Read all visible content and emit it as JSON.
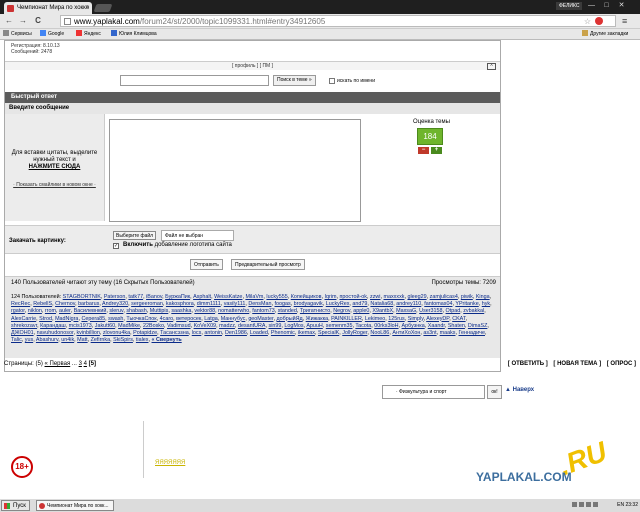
{
  "browser": {
    "tab_title": "Чемпионат Мира по хокке",
    "tab_close": "×",
    "user_label": "ФЕЛИКС",
    "url_host": "www.yaplakal.com",
    "url_path": "/forum24/st/2000/topic1099331.html#entry34912605",
    "win_min": "—",
    "win_max": "□",
    "win_close": "✕",
    "back": "←",
    "forward": "→",
    "reload": "C",
    "star": "☆",
    "menu": "≡"
  },
  "bookmarks": {
    "items": [
      "Сервисы",
      "Google",
      "Яндекс",
      "Юлия Климцова"
    ],
    "other": "Другие закладки"
  },
  "post": {
    "registration": "Регистрация: 8.10.13",
    "messages": "Сообщений: 2478",
    "profile_row": "[ профиль ] [ ПМ ]",
    "up": "^"
  },
  "search": {
    "button": "Поиск в теме »",
    "checkbox_label": "искать по имени"
  },
  "quick_reply": {
    "header": "Быстрый ответ",
    "message_label": "Введите сообщение",
    "quote_hint": "Для вставки цитаты, выделите нужный текст и",
    "quote_action": "НАЖМИТЕ СЮДА",
    "smilies_link": "· Показать смайлики в новом окне ·",
    "rating_title": "Оценка темы",
    "rating_value": "184",
    "rating_minus": "−",
    "rating_plus": "+"
  },
  "attachment": {
    "label": "Закачать картинку:",
    "choose_button": "Выберите файл",
    "file_info": "Файл не выбран",
    "watermark_check": "✓",
    "watermark_bold": "Включить",
    "watermark_rest": " добавление логотипа сайта"
  },
  "actions": {
    "send": "Отправить",
    "preview": "Предварительный просмотр"
  },
  "online": {
    "title": "140 Пользователей читают эту тему (16 Скрытых Пользователей)",
    "views": "Просмотры темы: 7209",
    "prefix": "124 Пользователей:",
    "users": [
      "STAGBORTNIK",
      "Paterson",
      "tatk77",
      "iBanov",
      "БуржаПик",
      "Asphalt",
      "WeissKatze",
      "MilaVm",
      "lucky555",
      "Копейщиков",
      "Iqrim",
      "простой-ok",
      "zzwi",
      "maxxxxk",
      "gleeg29",
      "zamjulicas4",
      "piwik",
      "Kinga",
      "RecRec",
      "RebellS",
      "Chernov",
      "barbarus",
      "Andrey320",
      "sergeeroman",
      "kakosphora",
      "dimm1111",
      "vasily111",
      "DensMan",
      "foogas",
      "brodyagavik",
      "LuckyRex",
      "and79",
      "Natalia68",
      "andrey110",
      "fantomas04",
      "YPritanke",
      "hyk",
      "rgator",
      "niklon",
      "rrom",
      "auler",
      "Василевнкий",
      "sleruv",
      "shabash",
      "Muttipis",
      "saashka",
      "vektor88",
      "nomatterwho",
      "fantom73",
      "standed",
      "Тригатнисто",
      "Negrov",
      "apple0",
      "Х9antbX",
      "MaxsaG",
      "User3158",
      "Otpad",
      "zvbakkal",
      "AlexCarrie",
      "Strod",
      "MadNigra",
      "Cepera85",
      "swash",
      "ТыочкаСпок",
      "4caro",
      "ветеросек",
      "Latga",
      "Маннубус",
      "geoMaster",
      "добрыйЯд",
      "Жижакка",
      "PAINKILLER",
      "Lekimeo",
      "125rus",
      "Simply",
      "AlexeyDP",
      "CKAT",
      "shrekozavr",
      "Карандаш",
      "mcis1973",
      "Jakutt60",
      "MadMike",
      "22Bosko",
      "Vadimsud",
      "KoVeX09",
      "madzz",
      "desantURA",
      "sin99",
      "LogMos",
      "ApuuH",
      "semenm35",
      "Tacota",
      "00rks3loH",
      "Арбузнка",
      "Xaandr",
      "Shaten",
      "DimaSZ",
      "ДЖОН01",
      "navuhudonosor",
      "kvinbillion",
      "zlovonu4ka",
      "Potapidze",
      "Тасансэзна",
      "locs",
      "antonin",
      "Den1986",
      "Loaded",
      "Phenomic",
      "ikemax",
      "SpecialK",
      "JollyRoger",
      "NooL86",
      "АнтиХоХон",
      "as3nt",
      "maaks",
      "Геннадиче",
      "Talic",
      "yus",
      "Abashurv",
      "un4ik",
      "Matt",
      "Zefirnka",
      "SkiSpirs",
      "tialex"
    ],
    "collapse": "« Свернуть"
  },
  "pager": {
    "label": "Страницы: (5)",
    "first": "« Первая",
    "dots": "...",
    "p3": "3",
    "p4": "4",
    "current": "[5]"
  },
  "thread_links": {
    "reply": "[ ОТВЕТИТЬ ]",
    "new_topic": "[ НОВАЯ ТЕМА ]",
    "poll": "[ ОПРОС ]"
  },
  "footer": {
    "category": "· Физкультура и спорт",
    "ok": "ок!",
    "back": "▲ Наверх",
    "age": "18+",
    "yellow_link": "ЯЯЯЯЯЯЯ",
    "logo": "YAPLAKAL.COM",
    "logo_ru": ".RU"
  },
  "taskbar": {
    "start": "Пуск",
    "task": "Чемпионат Мира по хокк...",
    "lang": "EN",
    "time": "23:32"
  },
  "colors": {
    "quick_reply_header": "#5b5b5b",
    "rating_green": "#6fb52c",
    "rating_minus": "#c0392b",
    "rating_plus": "#4a8a1e",
    "user_link": "#0b2b8a"
  }
}
